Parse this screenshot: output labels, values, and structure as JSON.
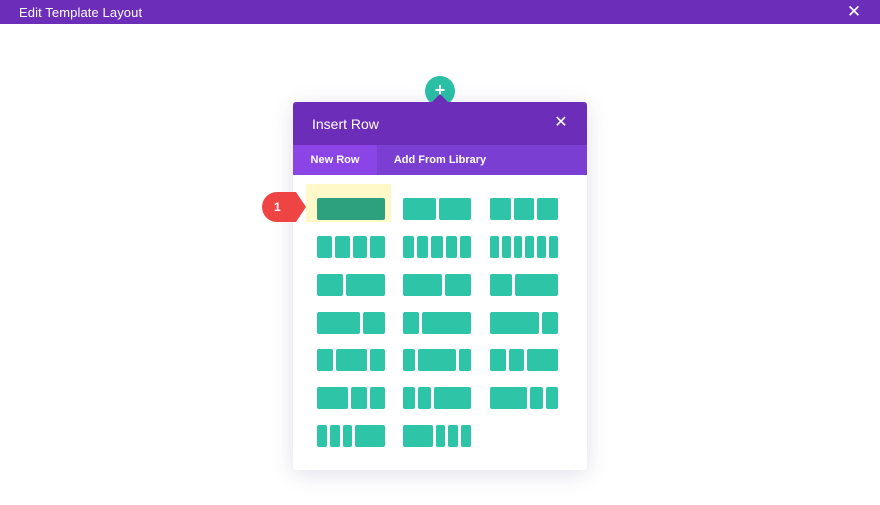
{
  "window": {
    "title": "Edit Template Layout",
    "close_icon": "close-icon",
    "color": "#6c2eb9"
  },
  "add_button": {
    "icon": "plus-icon",
    "symbol": "+"
  },
  "modal": {
    "title": "Insert Row",
    "close_icon": "close-icon",
    "tabs": [
      {
        "label": "New Row",
        "active": true
      },
      {
        "label": "Add From Library",
        "active": false
      }
    ],
    "column_color": "#2ec4a7",
    "selected_color": "#2da17d",
    "layouts": [
      {
        "name": "1 column",
        "fractions": [
          1
        ],
        "selected": true
      },
      {
        "name": "1/2 + 1/2",
        "fractions": [
          1,
          1
        ]
      },
      {
        "name": "1/3 + 1/3 + 1/3",
        "fractions": [
          1,
          1,
          1
        ]
      },
      {
        "name": "1/4 x 4",
        "fractions": [
          1,
          1,
          1,
          1
        ]
      },
      {
        "name": "1/5 x 5",
        "fractions": [
          1,
          1,
          1,
          1,
          1
        ]
      },
      {
        "name": "1/6 x 6",
        "fractions": [
          1,
          1,
          1,
          1,
          1,
          1
        ]
      },
      {
        "name": "2/5 + 3/5",
        "fractions": [
          2,
          3
        ]
      },
      {
        "name": "3/5 + 2/5",
        "fractions": [
          3,
          2
        ]
      },
      {
        "name": "1/3 + 2/3",
        "fractions": [
          1,
          2
        ]
      },
      {
        "name": "2/3 + 1/3",
        "fractions": [
          2,
          1
        ]
      },
      {
        "name": "1/4 + 3/4",
        "fractions": [
          1,
          3
        ]
      },
      {
        "name": "3/4 + 1/4",
        "fractions": [
          3,
          1
        ]
      },
      {
        "name": "1/4 + 1/2 + 1/4",
        "fractions": [
          1,
          2,
          1
        ]
      },
      {
        "name": "1/5 + 3/5 + 1/5",
        "fractions": [
          1,
          3,
          1
        ]
      },
      {
        "name": "1/4 + 1/4 + 1/2",
        "fractions": [
          1,
          1,
          2
        ]
      },
      {
        "name": "1/2 + 1/4 + 1/4",
        "fractions": [
          2,
          1,
          1
        ]
      },
      {
        "name": "1/5 + 1/5 + 3/5",
        "fractions": [
          1,
          1,
          3
        ]
      },
      {
        "name": "3/5 + 1/5 + 1/5",
        "fractions": [
          3,
          1,
          1
        ]
      },
      {
        "name": "1/6 x 2 + 1/2 (a)",
        "fractions": [
          1,
          1,
          1,
          3
        ]
      },
      {
        "name": "1/2 + 1/6 x 3",
        "fractions": [
          3,
          1,
          1,
          1
        ]
      }
    ]
  },
  "annotation": {
    "label": "1",
    "color": "#ef4444"
  }
}
